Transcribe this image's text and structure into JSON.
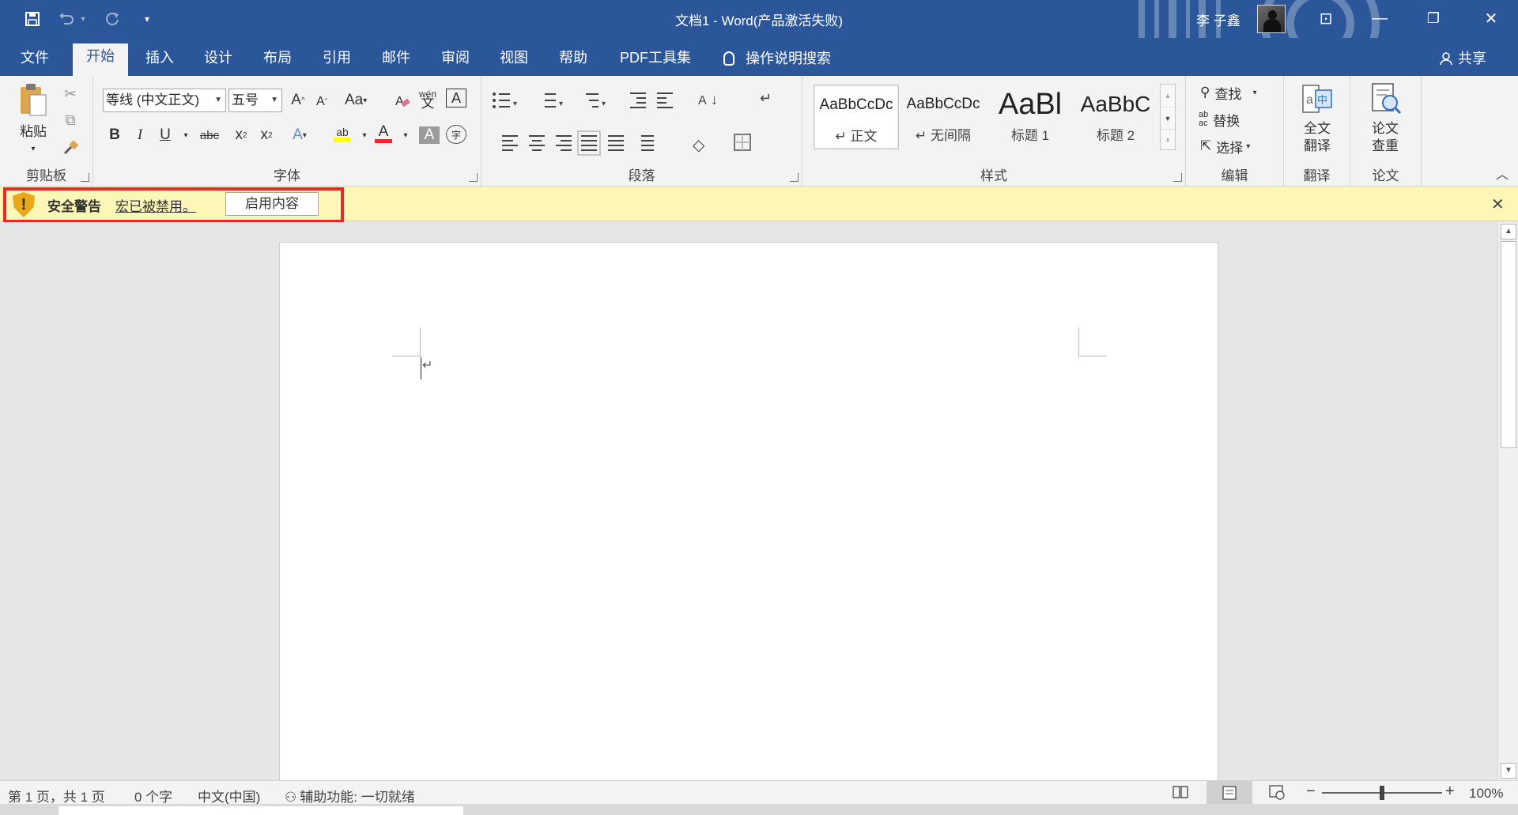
{
  "window": {
    "title": "文档1  -  Word(产品激活失败)",
    "user_name": "李 子鑫",
    "controls": {
      "ribbon_display": "⊡",
      "minimize": "—",
      "restore": "❐",
      "close": "✕"
    }
  },
  "quick_access": {
    "save_icon": "save-icon",
    "undo_icon": "undo-icon",
    "redo_icon": "redo-icon",
    "customize_icon": "customize-icon"
  },
  "tabs": [
    {
      "label": "文件"
    },
    {
      "label": "开始"
    },
    {
      "label": "插入"
    },
    {
      "label": "设计"
    },
    {
      "label": "布局"
    },
    {
      "label": "引用"
    },
    {
      "label": "邮件"
    },
    {
      "label": "审阅"
    },
    {
      "label": "视图"
    },
    {
      "label": "帮助"
    },
    {
      "label": "PDF工具集"
    }
  ],
  "active_tab": "开始",
  "tell_me": "操作说明搜索",
  "share": "共享",
  "ribbon": {
    "clipboard": {
      "label": "剪贴板",
      "paste": "粘贴"
    },
    "font": {
      "label": "字体",
      "font_name": "等线 (中文正文)",
      "font_size": "五号",
      "grow": "A",
      "shrink": "A",
      "case": "Aa",
      "phonetic": "wén",
      "border_char": "A",
      "bold": "B",
      "italic": "I",
      "underline": "U",
      "strike": "abc",
      "subscript": "x",
      "superscript": "x",
      "sub_mark": "2",
      "sup_mark": "2",
      "effects": "A",
      "highlight": "ab",
      "color": "A",
      "shading": "A",
      "enclose": "字"
    },
    "paragraph": {
      "label": "段落"
    },
    "styles": {
      "label": "样式",
      "items": [
        {
          "preview": "AaBbCcDc",
          "name": "正文"
        },
        {
          "preview": "AaBbCcDc",
          "name": "无间隔"
        },
        {
          "preview": "AaBl",
          "name": "标题 1"
        },
        {
          "preview": "AaBbC",
          "name": "标题 2"
        }
      ]
    },
    "editing": {
      "label": "编辑",
      "find": "查找",
      "replace": "替换",
      "select": "选择"
    },
    "translate": {
      "label": "翻译",
      "full_line1": "全文",
      "full_line2": "翻译"
    },
    "paper": {
      "label": "论文",
      "check_line1": "论文",
      "check_line2": "查重"
    }
  },
  "message_bar": {
    "title": "安全警告",
    "text": "宏已被禁用。",
    "button": "启用内容",
    "close": "✕"
  },
  "document": {
    "paragraph_mark": "↵"
  },
  "status": {
    "page": "第 1 页，共 1 页",
    "words": "0 个字",
    "language": "中文(中国)",
    "accessibility": "辅助功能: 一切就绪",
    "zoom_minus": "−",
    "zoom_plus": "+",
    "zoom": "100%",
    "zoom_fraction": 0.5
  },
  "colors": {
    "accent": "#2b579a",
    "warning_bar": "#fcf7b6",
    "highlight_box": "#e8282c"
  }
}
